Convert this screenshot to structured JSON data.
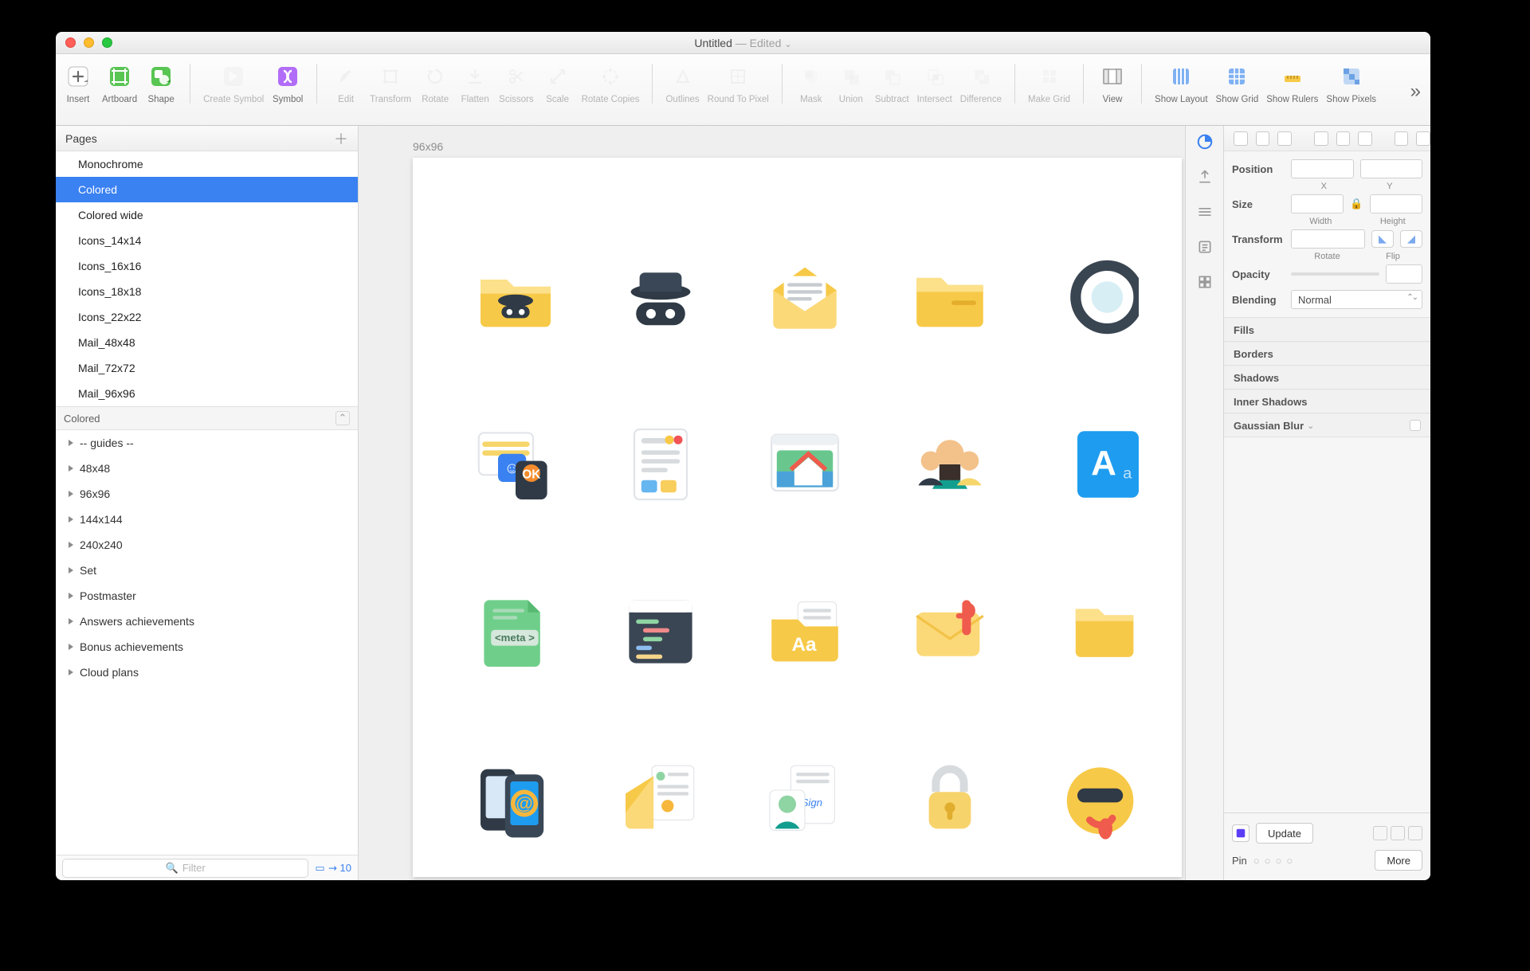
{
  "window": {
    "title_main": "Untitled",
    "title_suffix": " — Edited"
  },
  "toolbar": {
    "items": [
      {
        "label": "Insert",
        "disabled": false,
        "color": "#4a4a4a"
      },
      {
        "label": "Artboard",
        "disabled": false,
        "color": "#59c553"
      },
      {
        "label": "Shape",
        "disabled": false,
        "color": "#59c553"
      },
      {
        "label": "Create Symbol",
        "disabled": true
      },
      {
        "label": "Symbol",
        "disabled": false,
        "color": "#b26df8"
      },
      {
        "label": "Edit",
        "disabled": true
      },
      {
        "label": "Transform",
        "disabled": true
      },
      {
        "label": "Rotate",
        "disabled": true
      },
      {
        "label": "Flatten",
        "disabled": true
      },
      {
        "label": "Scissors",
        "disabled": true
      },
      {
        "label": "Scale",
        "disabled": true
      },
      {
        "label": "Rotate Copies",
        "disabled": true
      },
      {
        "label": "Outlines",
        "disabled": true
      },
      {
        "label": "Round To Pixel",
        "disabled": true
      },
      {
        "label": "Mask",
        "disabled": true
      },
      {
        "label": "Union",
        "disabled": true
      },
      {
        "label": "Subtract",
        "disabled": true
      },
      {
        "label": "Intersect",
        "disabled": true
      },
      {
        "label": "Difference",
        "disabled": true
      },
      {
        "label": "Make Grid",
        "disabled": true
      },
      {
        "label": "View",
        "disabled": false
      },
      {
        "label": "Show Layout",
        "disabled": false
      },
      {
        "label": "Show Grid",
        "disabled": false
      },
      {
        "label": "Show Rulers",
        "disabled": false
      },
      {
        "label": "Show Pixels",
        "disabled": false
      }
    ]
  },
  "pages_panel": {
    "title": "Pages",
    "pages": [
      "Monochrome",
      "Colored",
      "Colored wide",
      "Icons_14x14",
      "Icons_16x16",
      "Icons_18x18",
      "Icons_22x22",
      "Mail_48x48",
      "Mail_72x72",
      "Mail_96x96"
    ],
    "selected": "Colored"
  },
  "layers_panel": {
    "title": "Colored",
    "items": [
      "-- guides --",
      "48x48",
      "96x96",
      "144x144",
      "240x240",
      "Set",
      "Postmaster",
      "Answers achievements",
      "Bonus achievements",
      "Cloud plans"
    ]
  },
  "filter": {
    "placeholder": "Filter"
  },
  "zoom": "10",
  "canvas": {
    "artboard_label": "96x96",
    "icon_names": [
      "folder-spy-icon",
      "hat-mask-icon",
      "open-mail-icon",
      "folder-icon",
      "circle-ring-icon",
      "social-apps-icon",
      "document-card-icon",
      "browser-house-icon",
      "people-group-icon",
      "font-tile-icon",
      "meta-doc-icon",
      "code-window-icon",
      "font-folder-icon",
      "mail-attach-icon",
      "folder-stack-icon",
      "phones-at-icon",
      "mail-letter-icon",
      "id-card-icon",
      "padlock-icon",
      "emoji-cool-icon"
    ]
  },
  "inspector": {
    "position_label": "Position",
    "x_label": "X",
    "y_label": "Y",
    "size_label": "Size",
    "width_label": "Width",
    "height_label": "Height",
    "transform_label": "Transform",
    "rotate_label": "Rotate",
    "flip_label": "Flip",
    "opacity_label": "Opacity",
    "blending_label": "Blending",
    "blending_value": "Normal",
    "sections": [
      "Fills",
      "Borders",
      "Shadows",
      "Inner Shadows",
      "Gaussian Blur"
    ],
    "update_button": "Update",
    "pin_label": "Pin",
    "more_button": "More"
  }
}
